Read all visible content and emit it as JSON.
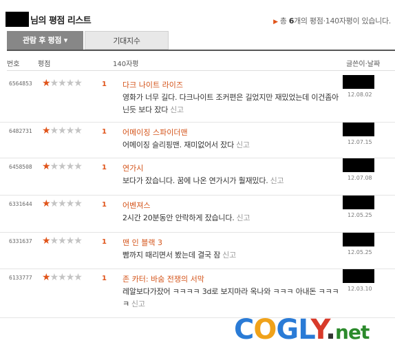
{
  "header": {
    "title": "님의 평점 리스트",
    "summary_prefix": "총 ",
    "summary_count": "6",
    "summary_suffix": "개의 평점·140자평이 있습니다."
  },
  "tabs": [
    {
      "label": "관람 후 평점 ▾",
      "active": true
    },
    {
      "label": "기대지수",
      "active": false
    }
  ],
  "columns": {
    "num": "번호",
    "rating": "평점",
    "review": "140자평",
    "writer_date": "글쓴이·날짜"
  },
  "report_label": "신고",
  "rows": [
    {
      "id": "6564853",
      "stars": 1,
      "score": "1",
      "movie": "다크 나이트 라이즈",
      "review": "영화가 너무 길다. 다크나이트 조커편은 길었지만 재밌었는데 이건좀아닌듯 보다 잤다",
      "date": "12.08.02"
    },
    {
      "id": "6482731",
      "stars": 1,
      "score": "1",
      "movie": "어메이징 스파이더맨",
      "review": "어메이징 슬리핑맨. 재미없어서 잤다",
      "date": "12.07.15"
    },
    {
      "id": "6458508",
      "stars": 1,
      "score": "1",
      "movie": "연가시",
      "review": "보다가 잤습니다. 꿈에 나온 연가시가 훨재밌다.",
      "date": "12.07.08"
    },
    {
      "id": "6331644",
      "stars": 1,
      "score": "1",
      "movie": "어벤져스",
      "review": "2시간 20분동안 안락하게 잤습니다.",
      "date": "12.05.25"
    },
    {
      "id": "6331637",
      "stars": 1,
      "score": "1",
      "movie": "맨 인 블랙 3",
      "review": "빰까지 때리면서 봤는데 결국 잠",
      "date": "12.05.25"
    },
    {
      "id": "6133777",
      "stars": 1,
      "score": "1",
      "movie": "존 카터: 바숨 전쟁의 서막",
      "review": "레알보다가잤어 ㅋㅋㅋㅋ 3d로 보지마라 옥나와 ㅋㅋㅋ 아내돈 ㅋㅋㅋㅋ",
      "date": "12.03.10"
    }
  ],
  "watermark": {
    "c": "C",
    "o": "O",
    "g": "G",
    "l": "L",
    "y": "Y",
    "dot": ".",
    "net": "net"
  }
}
